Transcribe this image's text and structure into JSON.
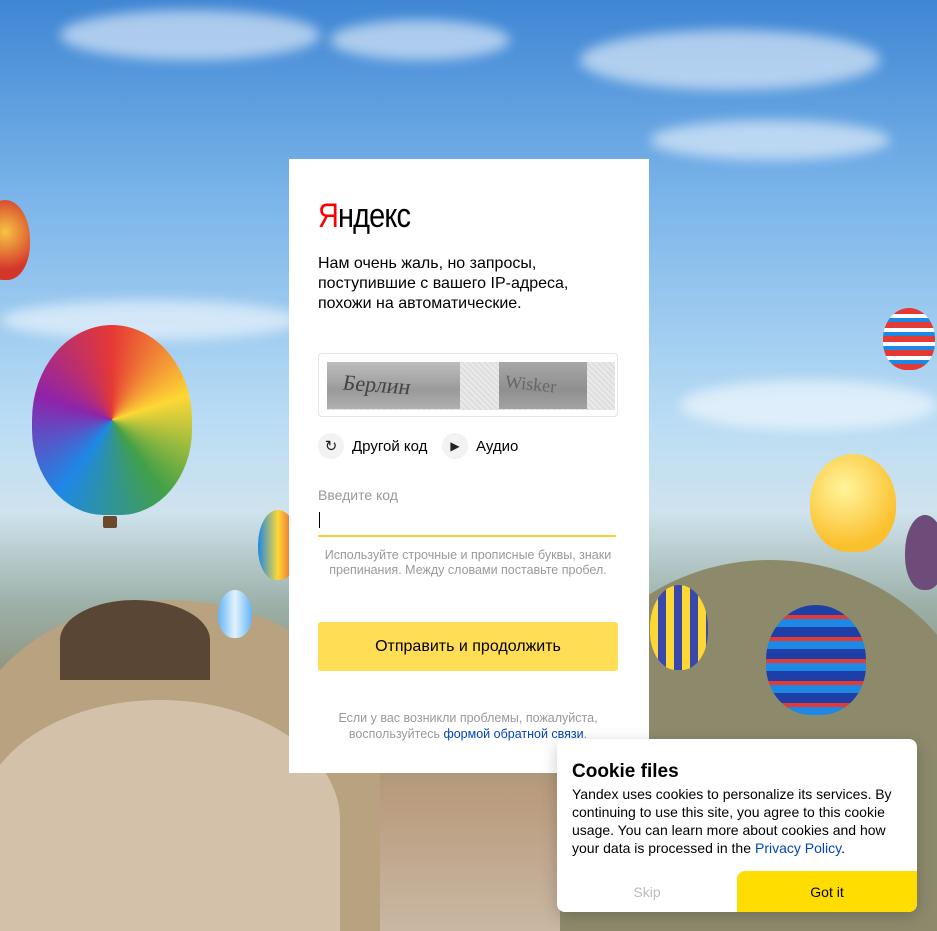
{
  "logo": {
    "first_letter": "Я",
    "rest": "ндекс"
  },
  "message": "Нам очень жаль, но запросы, поступившие с вашего IP-адреса, похожи на автоматические.",
  "captcha": {
    "word1": "Берлин",
    "word2": "Wisker"
  },
  "actions": {
    "other_code": "Другой код",
    "audio": "Аудио"
  },
  "input": {
    "label": "Введите код",
    "value": ""
  },
  "hint": "Используйте строчные и прописные буквы, знаки препинания. Между словами поставьте пробел.",
  "submit_label": "Отправить и продолжить",
  "footer": {
    "prefix": "Если у вас возникли проблемы, пожалуйста, воспользуйтесь ",
    "link": "формой обратной связи",
    "suffix": "."
  },
  "cookie": {
    "title": "Cookie files",
    "text": "Yandex uses cookies to personalize its services. By continuing to use this site, you agree to this cookie usage. You can learn more about cookies and how your data is processed in the",
    "link": "Privacy Policy",
    "link_suffix": ".",
    "skip": "Skip",
    "accept": "Got it"
  },
  "icons": {
    "refresh": "refresh-icon",
    "play": "play-icon"
  },
  "colors": {
    "accent_yellow": "#ffdd55",
    "logo_red": "#ff0000",
    "link_blue": "#0044bb"
  }
}
